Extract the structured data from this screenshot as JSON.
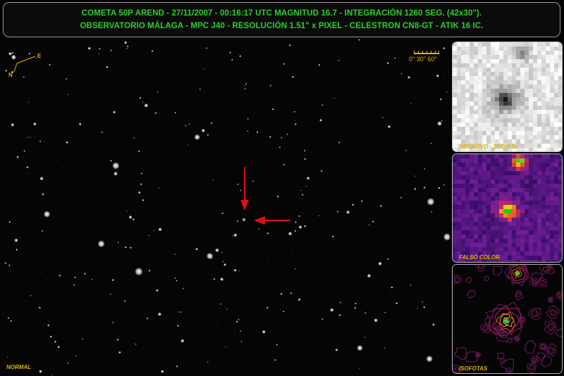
{
  "header": {
    "line1": "COMETA 50P AREND - 27/11/2007 - 00:16:17 UTC MAGNITUD 16.7 - INTEGRACIÓN 1260 SEG. (42x30\").",
    "line2": "OBSERVATORIO MÁLAGA  - MPC J40 - RESOLUCIÓN 1.51\" x PIXEL - CELESTRON CN8-GT - ATIK 16 IC."
  },
  "field": {
    "label": "NORMAL",
    "compass": {
      "north": "N",
      "east": "E"
    },
    "scale": {
      "ticks": "0\"  30\"  60\""
    },
    "marker_color": "#e01010"
  },
  "panels": {
    "negative": {
      "label": "NEGATIVO - ZOOM 5x"
    },
    "false_color": {
      "label": "FALSO COLOR"
    },
    "isophotes": {
      "label": "ISOFOTAS"
    }
  },
  "colors": {
    "header_text": "#2bd12b",
    "label_text": "#e0b400"
  }
}
